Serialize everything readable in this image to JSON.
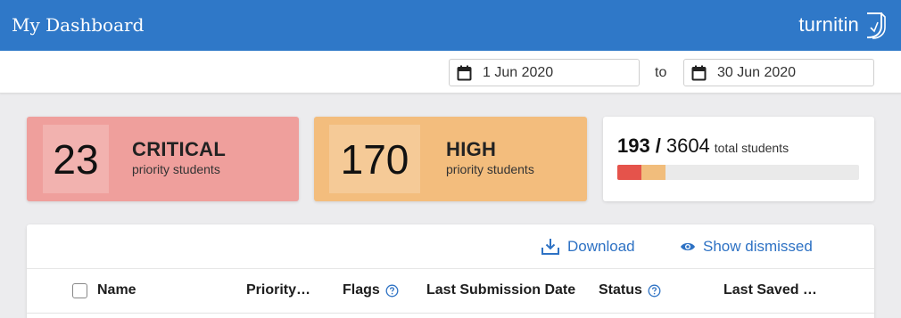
{
  "header": {
    "title": "My Dashboard",
    "logo_text": "turnitin",
    "brand_color": "#2f78c8"
  },
  "date_filter": {
    "start": "1 Jun 2020",
    "to_label": "to",
    "end": "30 Jun 2020",
    "icon": "calendar-icon"
  },
  "summary": {
    "critical": {
      "count": "23",
      "level": "CRITICAL",
      "label": "priority students",
      "color": "#ef9f9c"
    },
    "high": {
      "count": "170",
      "level": "HIGH",
      "label": "priority students",
      "color": "#f3bd7d"
    },
    "total": {
      "flagged": "193",
      "separator": "/",
      "all": "3604",
      "label": "total students",
      "critical_fraction": 0.0064,
      "high_fraction": 0.0471
    }
  },
  "actions": {
    "download": {
      "label": "Download",
      "icon": "download-icon"
    },
    "show_dismissed": {
      "label": "Show dismissed",
      "icon": "eye-icon"
    },
    "accent_color": "#2e72c4"
  },
  "table": {
    "columns": [
      {
        "label": "Name",
        "has_help": false
      },
      {
        "label": "Priority…",
        "has_help": false
      },
      {
        "label": "Flags",
        "has_help": true
      },
      {
        "label": "Last Submission Date",
        "has_help": false
      },
      {
        "label": "Status",
        "has_help": true
      },
      {
        "label": "Last Saved …",
        "has_help": false
      }
    ]
  }
}
